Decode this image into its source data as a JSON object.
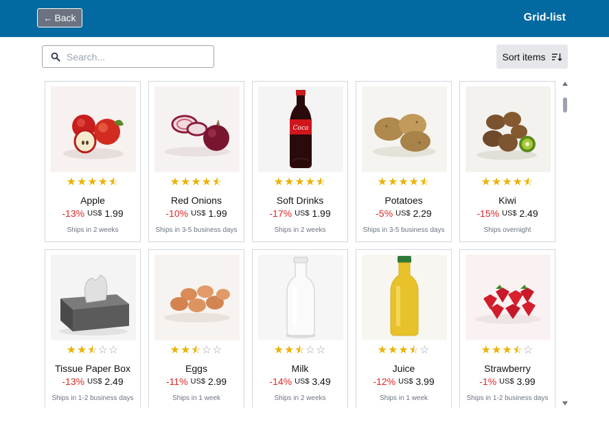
{
  "header": {
    "back_label": "Back",
    "title": "Grid-list"
  },
  "search": {
    "placeholder": "Search..."
  },
  "sort": {
    "label": "Sort items"
  },
  "colors": {
    "header_bg": "#0369a1",
    "discount": "#dc2626",
    "star": "#eab308"
  },
  "products": [
    {
      "name": "Apple",
      "rating": 4.5,
      "discount": "-13%",
      "currency": "US$",
      "price": "1.99",
      "shipping": "Ships in 2 weeks",
      "image": "apples"
    },
    {
      "name": "Red Onions",
      "rating": 4.5,
      "discount": "-10%",
      "currency": "US$",
      "price": "1.99",
      "shipping": "Ships in 3-5 business days",
      "image": "red-onions"
    },
    {
      "name": "Soft Drinks",
      "rating": 4.5,
      "discount": "-17%",
      "currency": "US$",
      "price": "1.99",
      "shipping": "Ships in 2 weeks",
      "image": "cola-bottle"
    },
    {
      "name": "Potatoes",
      "rating": 4.5,
      "discount": "-5%",
      "currency": "US$",
      "price": "2.29",
      "shipping": "Ships in 3-5 business days",
      "image": "potatoes"
    },
    {
      "name": "Kiwi",
      "rating": 4.5,
      "discount": "-15%",
      "currency": "US$",
      "price": "2.49",
      "shipping": "Ships overnight",
      "image": "kiwis"
    },
    {
      "name": "Tissue Paper Box",
      "rating": 2.5,
      "discount": "-13%",
      "currency": "US$",
      "price": "2.49",
      "shipping": "Ships in 1-2 business days",
      "image": "tissue-box"
    },
    {
      "name": "Eggs",
      "rating": 2.5,
      "discount": "-11%",
      "currency": "US$",
      "price": "2.99",
      "shipping": "Ships in 1 week",
      "image": "eggs"
    },
    {
      "name": "Milk",
      "rating": 2.5,
      "discount": "-14%",
      "currency": "US$",
      "price": "3.49",
      "shipping": "Ships in 2 weeks",
      "image": "milk-bottle"
    },
    {
      "name": "Juice",
      "rating": 3.5,
      "discount": "-12%",
      "currency": "US$",
      "price": "3.99",
      "shipping": "Ships in 1 week",
      "image": "juice-bottle"
    },
    {
      "name": "Strawberry",
      "rating": 3.5,
      "discount": "-1%",
      "currency": "US$",
      "price": "3.99",
      "shipping": "Ships in 1-2 business days",
      "image": "strawberries"
    }
  ]
}
